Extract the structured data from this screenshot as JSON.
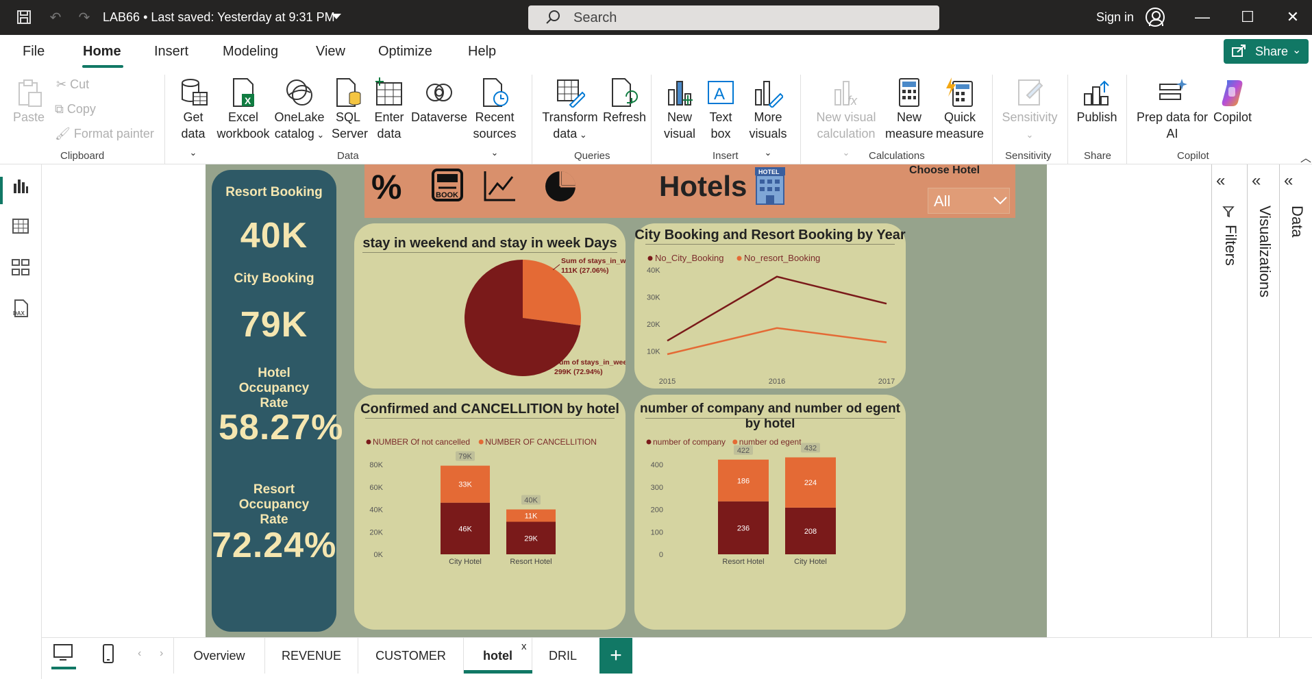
{
  "titlebar": {
    "doc_title": "LAB66",
    "saved_status": "Last saved: Yesterday at 9:31 PM",
    "separator": "•",
    "search_placeholder": "Search",
    "sign_in": "Sign in"
  },
  "menu": {
    "items": [
      "File",
      "Home",
      "Insert",
      "Modeling",
      "View",
      "Optimize",
      "Help"
    ],
    "active": "Home",
    "share": "Share"
  },
  "ribbon": {
    "clipboard": {
      "paste": "Paste",
      "cut": "Cut",
      "copy": "Copy",
      "format_painter": "Format painter",
      "group": "Clipboard"
    },
    "data": {
      "get_data": [
        "Get",
        "data"
      ],
      "excel": [
        "Excel",
        "workbook"
      ],
      "onelake": [
        "OneLake",
        "catalog"
      ],
      "sql": [
        "SQL",
        "Server"
      ],
      "enter": [
        "Enter",
        "data"
      ],
      "dataverse": [
        "Dataverse",
        ""
      ],
      "recent": [
        "Recent",
        "sources"
      ],
      "group": "Data"
    },
    "queries": {
      "transform": [
        "Transform",
        "data"
      ],
      "refresh": [
        "Refresh",
        ""
      ],
      "group": "Queries"
    },
    "insert": {
      "new_visual": [
        "New",
        "visual"
      ],
      "text_box": [
        "Text",
        "box"
      ],
      "more_visuals": [
        "More",
        "visuals"
      ],
      "group": "Insert"
    },
    "calculations": {
      "new_visual_calc": [
        "New visual",
        "calculation"
      ],
      "new_measure": [
        "New",
        "measure"
      ],
      "quick_measure": [
        "Quick",
        "measure"
      ],
      "group": "Calculations"
    },
    "sensitivity": {
      "label": "Sensitivity",
      "group": "Sensitivity"
    },
    "share": {
      "publish": "Publish",
      "group": "Share"
    },
    "copilot": {
      "prep": [
        "Prep data for",
        "AI"
      ],
      "copilot": "Copilot",
      "group": "Copilot"
    }
  },
  "right_panes": {
    "filters": "Filters",
    "visualizations": "Visualizations",
    "data": "Data"
  },
  "report": {
    "kpis": [
      {
        "label": "Resort Booking",
        "value": "40K"
      },
      {
        "label": "City Booking",
        "value": "79K"
      },
      {
        "label": "Hotel Occupancy Rate",
        "value": "58.27%"
      },
      {
        "label": "Resort Occupancy Rate",
        "value": "72.24%"
      }
    ],
    "header": {
      "title": "Hotels",
      "hotel_sign": "HOTEL",
      "book_label": "BOOK",
      "percent_icon": "%",
      "chooser_label": "Choose Hotel",
      "chooser_value": "All"
    }
  },
  "chart_data": [
    {
      "type": "pie",
      "title": "stay in weekend and stay in week Days",
      "categories": [
        "Sum of stays_in_weekend_nights",
        "Sum of stays_in_week_nights"
      ],
      "values": [
        111,
        299
      ],
      "data_labels": [
        "111K (27.06%)",
        "299K (72.94%)"
      ],
      "colors": [
        "#e46a35",
        "#7a1a1a"
      ]
    },
    {
      "type": "line",
      "title": "City Booking and Resort Booking by Year",
      "x": [
        "2015",
        "2016",
        "2017"
      ],
      "series": [
        {
          "name": "No_City_Booking",
          "values": [
            13800,
            37500,
            27500
          ],
          "color": "#7a1a1a"
        },
        {
          "name": "No_resort_Booking",
          "values": [
            8800,
            18500,
            13200
          ],
          "color": "#e46a35"
        }
      ],
      "yticks": [
        "10K",
        "20K",
        "30K",
        "40K"
      ],
      "ylim": [
        5000,
        42000
      ]
    },
    {
      "type": "bar",
      "stacked": true,
      "title": "Confirmed and CANCELLITION by hotel",
      "categories": [
        "City Hotel",
        "Resort Hotel"
      ],
      "series": [
        {
          "name": "NUMBER Of not cancelled",
          "values": [
            46,
            29
          ],
          "labels": [
            "46K",
            "29K"
          ],
          "color": "#7a1a1a"
        },
        {
          "name": "NUMBER OF CANCELLITION",
          "values": [
            33,
            11
          ],
          "labels": [
            "33K",
            "11K"
          ],
          "color": "#e46a35"
        }
      ],
      "totals": [
        "79K",
        "40K"
      ],
      "yticks": [
        "0K",
        "20K",
        "40K",
        "60K",
        "80K"
      ],
      "ylim": [
        0,
        80
      ]
    },
    {
      "type": "bar",
      "stacked": true,
      "title": "number of company and number od egent by hotel",
      "categories": [
        "Resort Hotel",
        "City Hotel"
      ],
      "series": [
        {
          "name": "number of company",
          "values": [
            236,
            208
          ],
          "labels": [
            "236",
            "208"
          ],
          "color": "#7a1a1a"
        },
        {
          "name": "number od egent",
          "values": [
            186,
            224
          ],
          "labels": [
            "186",
            "224"
          ],
          "color": "#e46a35"
        }
      ],
      "totals": [
        "422",
        "432"
      ],
      "yticks": [
        "0",
        "100",
        "200",
        "300",
        "400"
      ],
      "ylim": [
        0,
        400
      ]
    }
  ],
  "page_tabs": {
    "tabs": [
      "Overview",
      "REVENUE",
      "CUSTOMER",
      "hotel",
      "DRIL"
    ],
    "active": "hotel",
    "close": "x",
    "add": "+"
  }
}
